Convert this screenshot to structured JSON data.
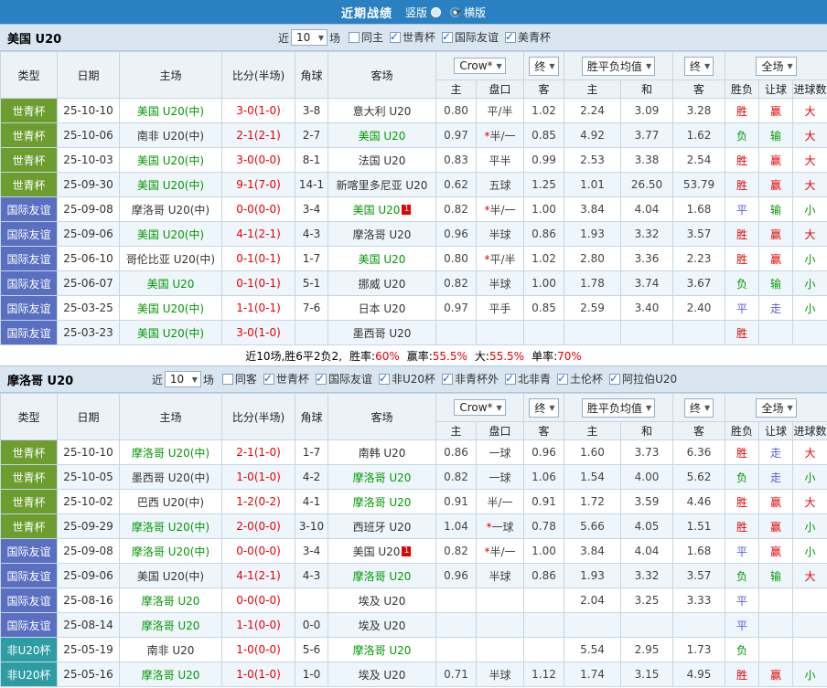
{
  "topbar": {
    "title": "近期战绩",
    "radios": [
      {
        "label": "竖版",
        "selected": false
      },
      {
        "label": "横版",
        "selected": true
      }
    ]
  },
  "table_header": {
    "type": "类型",
    "date": "日期",
    "home": "主场",
    "score": "比分(半场)",
    "corner": "角球",
    "away": "客场",
    "crow_select": "Crow*",
    "final_select": "终",
    "avg_select": "胜平负均值",
    "final_select2": "终",
    "full_select": "全场",
    "sub_home": "主",
    "sub_handicap": "盘口",
    "sub_away": "客",
    "sub_eu_home": "主",
    "sub_eu_draw": "和",
    "sub_eu_away": "客",
    "sub_wdl": "胜负",
    "sub_hc_result": "让球",
    "sub_goals": "进球数"
  },
  "colors": {
    "accent_blue": "#2b80c2",
    "win_red": "#e60000",
    "lose_green": "#009900",
    "draw_blue": "#5b5bd6",
    "type_worldcup": "#6d9c2f",
    "type_friendly": "#5a6fc0",
    "type_africa": "#2e9ca3"
  },
  "sections": [
    {
      "team": "美国 U20",
      "filter": {
        "near": "近",
        "count": "10",
        "games": "场"
      },
      "filters": [
        {
          "label": "同主",
          "checked": false
        },
        {
          "label": "世青杯",
          "checked": true
        },
        {
          "label": "国际友谊",
          "checked": true
        },
        {
          "label": "美青杯",
          "checked": true
        }
      ],
      "rows": [
        {
          "type": "世青杯",
          "date": "25-10-10",
          "home": "美国 U20(中)",
          "home_focal": true,
          "score": "3-0(1-0)",
          "corners": "3-8",
          "away": "意大利 U20",
          "away_focal": false,
          "away_badge": "",
          "odds_home": "0.80",
          "handicap": "平/半",
          "handicap_star": false,
          "odds_away": "1.02",
          "eu_home": "2.24",
          "eu_draw": "3.09",
          "eu_away": "3.28",
          "result_wdl": "胜",
          "result_handicap": "赢",
          "result_goals": "大"
        },
        {
          "type": "世青杯",
          "date": "25-10-06",
          "home": "南非 U20(中)",
          "home_focal": false,
          "score": "2-1(2-1)",
          "corners": "2-7",
          "away": "美国 U20",
          "away_focal": true,
          "away_badge": "",
          "odds_home": "0.97",
          "handicap": "半/一",
          "handicap_star": true,
          "odds_away": "0.85",
          "eu_home": "4.92",
          "eu_draw": "3.77",
          "eu_away": "1.62",
          "result_wdl": "负",
          "result_handicap": "输",
          "result_goals": "大"
        },
        {
          "type": "世青杯",
          "date": "25-10-03",
          "home": "美国 U20(中)",
          "home_focal": true,
          "score": "3-0(0-0)",
          "corners": "8-1",
          "away": "法国 U20",
          "away_focal": false,
          "away_badge": "",
          "odds_home": "0.83",
          "handicap": "平半",
          "handicap_star": false,
          "odds_away": "0.99",
          "eu_home": "2.53",
          "eu_draw": "3.38",
          "eu_away": "2.54",
          "result_wdl": "胜",
          "result_handicap": "赢",
          "result_goals": "大"
        },
        {
          "type": "世青杯",
          "date": "25-09-30",
          "home": "美国 U20(中)",
          "home_focal": true,
          "score": "9-1(7-0)",
          "corners": "14-1",
          "away": "新喀里多尼亚 U20",
          "away_focal": false,
          "away_badge": "",
          "odds_home": "0.62",
          "handicap": "五球",
          "handicap_star": false,
          "odds_away": "1.25",
          "eu_home": "1.01",
          "eu_draw": "26.50",
          "eu_away": "53.79",
          "result_wdl": "胜",
          "result_handicap": "赢",
          "result_goals": "大"
        },
        {
          "type": "国际友谊",
          "date": "25-09-08",
          "home": "摩洛哥 U20(中)",
          "home_focal": false,
          "score": "0-0(0-0)",
          "corners": "3-4",
          "away": "美国 U20",
          "away_focal": true,
          "away_badge": "1",
          "odds_home": "0.82",
          "handicap": "半/一",
          "handicap_star": true,
          "odds_away": "1.00",
          "eu_home": "3.84",
          "eu_draw": "4.04",
          "eu_away": "1.68",
          "result_wdl": "平",
          "result_handicap": "输",
          "result_goals": "小"
        },
        {
          "type": "国际友谊",
          "date": "25-09-06",
          "home": "美国 U20(中)",
          "home_focal": true,
          "score": "4-1(2-1)",
          "corners": "4-3",
          "away": "摩洛哥 U20",
          "away_focal": false,
          "away_badge": "",
          "odds_home": "0.96",
          "handicap": "半球",
          "handicap_star": false,
          "odds_away": "0.86",
          "eu_home": "1.93",
          "eu_draw": "3.32",
          "eu_away": "3.57",
          "result_wdl": "胜",
          "result_handicap": "赢",
          "result_goals": "大"
        },
        {
          "type": "国际友谊",
          "date": "25-06-10",
          "home": "哥伦比亚 U20(中)",
          "home_focal": false,
          "score": "0-1(0-1)",
          "corners": "1-7",
          "away": "美国 U20",
          "away_focal": true,
          "away_badge": "",
          "odds_home": "0.80",
          "handicap": "平/半",
          "handicap_star": true,
          "odds_away": "1.02",
          "eu_home": "2.80",
          "eu_draw": "3.36",
          "eu_away": "2.23",
          "result_wdl": "胜",
          "result_handicap": "赢",
          "result_goals": "小"
        },
        {
          "type": "国际友谊",
          "date": "25-06-07",
          "home": "美国 U20",
          "home_focal": true,
          "score": "0-1(0-1)",
          "corners": "5-1",
          "away": "挪威 U20",
          "away_focal": false,
          "away_badge": "",
          "odds_home": "0.82",
          "handicap": "半球",
          "handicap_star": false,
          "odds_away": "1.00",
          "eu_home": "1.78",
          "eu_draw": "3.74",
          "eu_away": "3.67",
          "result_wdl": "负",
          "result_handicap": "输",
          "result_goals": "小"
        },
        {
          "type": "国际友谊",
          "date": "25-03-25",
          "home": "美国 U20(中)",
          "home_focal": true,
          "score": "1-1(0-1)",
          "corners": "7-6",
          "away": "日本 U20",
          "away_focal": false,
          "away_badge": "",
          "odds_home": "0.97",
          "handicap": "平手",
          "handicap_star": false,
          "odds_away": "0.85",
          "eu_home": "2.59",
          "eu_draw": "3.40",
          "eu_away": "2.40",
          "result_wdl": "平",
          "result_handicap": "走",
          "result_goals": "小"
        },
        {
          "type": "国际友谊",
          "date": "25-03-23",
          "home": "美国 U20(中)",
          "home_focal": true,
          "score": "3-0(1-0)",
          "corners": "",
          "away": "墨西哥 U20",
          "away_focal": false,
          "away_badge": "",
          "odds_home": "",
          "handicap": "",
          "handicap_star": false,
          "odds_away": "",
          "eu_home": "",
          "eu_draw": "",
          "eu_away": "",
          "result_wdl": "胜",
          "result_handicap": "",
          "result_goals": ""
        }
      ],
      "summary": {
        "prefix": "近10场,胜6平2负2,",
        "stats": [
          {
            "label": "胜率:",
            "value": "60%"
          },
          {
            "label": "赢率:",
            "value": "55.5%"
          },
          {
            "label": "大:",
            "value": "55.5%"
          },
          {
            "label": "单率:",
            "value": "70%"
          }
        ]
      }
    },
    {
      "team": "摩洛哥 U20",
      "filter": {
        "near": "近",
        "count": "10",
        "games": "场"
      },
      "filters": [
        {
          "label": "同客",
          "checked": false
        },
        {
          "label": "世青杯",
          "checked": true
        },
        {
          "label": "国际友谊",
          "checked": true
        },
        {
          "label": "非U20杯",
          "checked": true
        },
        {
          "label": "非青杯外",
          "checked": true
        },
        {
          "label": "北非青",
          "checked": true
        },
        {
          "label": "土伦杯",
          "checked": true
        },
        {
          "label": "阿拉伯U20",
          "checked": true
        }
      ],
      "rows": [
        {
          "type": "世青杯",
          "date": "25-10-10",
          "home": "摩洛哥 U20(中)",
          "home_focal": true,
          "score": "2-1(1-0)",
          "corners": "1-7",
          "away": "南韩 U20",
          "away_focal": false,
          "away_badge": "",
          "odds_home": "0.86",
          "handicap": "一球",
          "handicap_star": false,
          "odds_away": "0.96",
          "eu_home": "1.60",
          "eu_draw": "3.73",
          "eu_away": "6.36",
          "result_wdl": "胜",
          "result_handicap": "走",
          "result_goals": "大"
        },
        {
          "type": "世青杯",
          "date": "25-10-05",
          "home": "墨西哥 U20(中)",
          "home_focal": false,
          "score": "1-0(1-0)",
          "corners": "4-2",
          "away": "摩洛哥 U20",
          "away_focal": true,
          "away_badge": "",
          "odds_home": "0.82",
          "handicap": "一球",
          "handicap_star": false,
          "odds_away": "1.06",
          "eu_home": "1.54",
          "eu_draw": "4.00",
          "eu_away": "5.62",
          "result_wdl": "负",
          "result_handicap": "走",
          "result_goals": "小"
        },
        {
          "type": "世青杯",
          "date": "25-10-02",
          "home": "巴西 U20(中)",
          "home_focal": false,
          "score": "1-2(0-2)",
          "corners": "4-1",
          "away": "摩洛哥 U20",
          "away_focal": true,
          "away_badge": "",
          "odds_home": "0.91",
          "handicap": "半/一",
          "handicap_star": false,
          "odds_away": "0.91",
          "eu_home": "1.72",
          "eu_draw": "3.59",
          "eu_away": "4.46",
          "result_wdl": "胜",
          "result_handicap": "赢",
          "result_goals": "大"
        },
        {
          "type": "世青杯",
          "date": "25-09-29",
          "home": "摩洛哥 U20(中)",
          "home_focal": true,
          "score": "2-0(0-0)",
          "corners": "3-10",
          "away": "西班牙 U20",
          "away_focal": false,
          "away_badge": "",
          "odds_home": "1.04",
          "handicap": "一球",
          "handicap_star": true,
          "odds_away": "0.78",
          "eu_home": "5.66",
          "eu_draw": "4.05",
          "eu_away": "1.51",
          "result_wdl": "胜",
          "result_handicap": "赢",
          "result_goals": "小"
        },
        {
          "type": "国际友谊",
          "date": "25-09-08",
          "home": "摩洛哥 U20(中)",
          "home_focal": true,
          "score": "0-0(0-0)",
          "corners": "3-4",
          "away": "美国 U20",
          "away_focal": false,
          "away_badge": "1",
          "odds_home": "0.82",
          "handicap": "半/一",
          "handicap_star": true,
          "odds_away": "1.00",
          "eu_home": "3.84",
          "eu_draw": "4.04",
          "eu_away": "1.68",
          "result_wdl": "平",
          "result_handicap": "赢",
          "result_goals": "小"
        },
        {
          "type": "国际友谊",
          "date": "25-09-06",
          "home": "美国 U20(中)",
          "home_focal": false,
          "score": "4-1(2-1)",
          "corners": "4-3",
          "away": "摩洛哥 U20",
          "away_focal": true,
          "away_badge": "",
          "odds_home": "0.96",
          "handicap": "半球",
          "handicap_star": false,
          "odds_away": "0.86",
          "eu_home": "1.93",
          "eu_draw": "3.32",
          "eu_away": "3.57",
          "result_wdl": "负",
          "result_handicap": "输",
          "result_goals": "大"
        },
        {
          "type": "国际友谊",
          "date": "25-08-16",
          "home": "摩洛哥 U20",
          "home_focal": true,
          "score": "0-0(0-0)",
          "corners": "",
          "away": "埃及 U20",
          "away_focal": false,
          "away_badge": "",
          "odds_home": "",
          "handicap": "",
          "handicap_star": false,
          "odds_away": "",
          "eu_home": "2.04",
          "eu_draw": "3.25",
          "eu_away": "3.33",
          "result_wdl": "平",
          "result_handicap": "",
          "result_goals": ""
        },
        {
          "type": "国际友谊",
          "date": "25-08-14",
          "home": "摩洛哥 U20",
          "home_focal": true,
          "score": "1-1(0-0)",
          "corners": "0-0",
          "away": "埃及 U20",
          "away_focal": false,
          "away_badge": "",
          "odds_home": "",
          "handicap": "",
          "handicap_star": false,
          "odds_away": "",
          "eu_home": "",
          "eu_draw": "",
          "eu_away": "",
          "result_wdl": "平",
          "result_handicap": "",
          "result_goals": ""
        },
        {
          "type": "非U20杯",
          "date": "25-05-19",
          "home": "南非 U20",
          "home_focal": false,
          "score": "1-0(0-0)",
          "corners": "5-6",
          "away": "摩洛哥 U20",
          "away_focal": true,
          "away_badge": "",
          "odds_home": "",
          "handicap": "",
          "handicap_star": false,
          "odds_away": "",
          "eu_home": "5.54",
          "eu_draw": "2.95",
          "eu_away": "1.73",
          "result_wdl": "负",
          "result_handicap": "",
          "result_goals": ""
        },
        {
          "type": "非U20杯",
          "date": "25-05-16",
          "home": "摩洛哥 U20",
          "home_focal": true,
          "score": "1-0(1-0)",
          "corners": "1-0",
          "away": "埃及 U20",
          "away_focal": false,
          "away_badge": "",
          "odds_home": "0.71",
          "handicap": "半球",
          "handicap_star": false,
          "odds_away": "1.12",
          "eu_home": "1.74",
          "eu_draw": "3.15",
          "eu_away": "4.95",
          "result_wdl": "胜",
          "result_handicap": "赢",
          "result_goals": "小"
        }
      ],
      "summary": null
    }
  ]
}
